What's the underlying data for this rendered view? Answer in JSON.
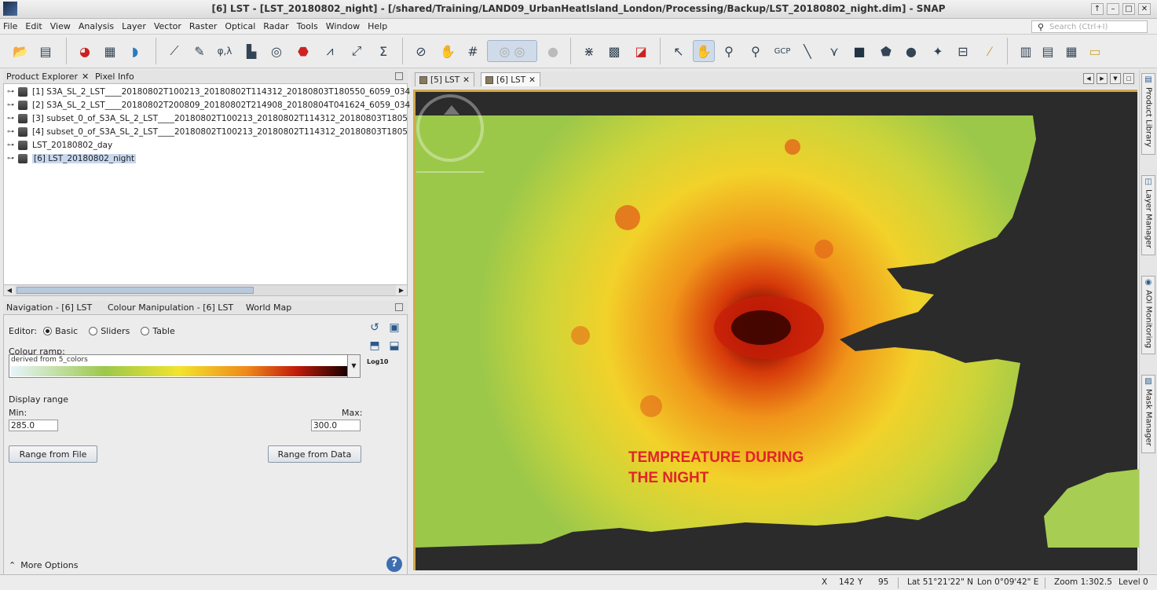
{
  "window": {
    "title": "[6] LST - [LST_20180802_night] - [/shared/Training/LAND09_UrbanHeatIsland_London/Processing/Backup/LST_20180802_night.dim] - SNAP"
  },
  "menu": [
    "File",
    "Edit",
    "View",
    "Analysis",
    "Layer",
    "Vector",
    "Raster",
    "Optical",
    "Radar",
    "Tools",
    "Window",
    "Help"
  ],
  "search": {
    "placeholder": "Search (Ctrl+I)"
  },
  "product_explorer": {
    "tabs": [
      "Product Explorer",
      "Pixel Info"
    ],
    "products": [
      "[1] S3A_SL_2_LST____20180802T100213_20180802T114312_20180803T180550_6059_034",
      "[2] S3A_SL_2_LST____20180802T200809_20180802T214908_20180804T041624_6059_034",
      "[3] subset_0_of_S3A_SL_2_LST____20180802T100213_20180802T114312_20180803T1805",
      "[4] subset_0_of_S3A_SL_2_LST____20180802T100213_20180802T114312_20180803T1805",
      "LST_20180802_day",
      "[6] LST_20180802_night"
    ]
  },
  "lower_panel": {
    "tabs": [
      "Navigation - [6] LST",
      "Colour Manipulation - [6] LST",
      "World Map"
    ],
    "editor_label": "Editor:",
    "editor_options": [
      "Basic",
      "Sliders",
      "Table"
    ],
    "colour_ramp_label": "Colour ramp:",
    "ramp_name": "derived from 5_colors",
    "log_label": "Log10",
    "display_range_label": "Display range",
    "min_label": "Min:",
    "max_label": "Max:",
    "min_value": "285.0",
    "max_value": "300.0",
    "range_from_file": "Range from File",
    "range_from_data": "Range from Data",
    "more_options": "More Options"
  },
  "image_tabs": [
    "[5] LST",
    "[6] LST"
  ],
  "overlay_text": [
    "TEMPREATURE DURING",
    "THE NIGHT"
  ],
  "right_tabs": [
    "Product Library",
    "Layer Manager",
    "AOI Monitoring",
    "Mask Manager"
  ],
  "status": {
    "x_label": "X",
    "x_value": "142",
    "y_label": "Y",
    "y_value": "95",
    "lat": "Lat 51°21'22\" N",
    "lon": "Lon 0°09'42\" E",
    "zoom": "Zoom 1:302.5",
    "level": "Level 0"
  },
  "colors": {
    "ramp": [
      "#e6f5fb",
      "#9cc84a",
      "#f2e42c",
      "#f08a1a",
      "#c01a0a",
      "#1a0000"
    ],
    "overlay_text": "#e0242a",
    "sea": "#2b2b2b"
  }
}
